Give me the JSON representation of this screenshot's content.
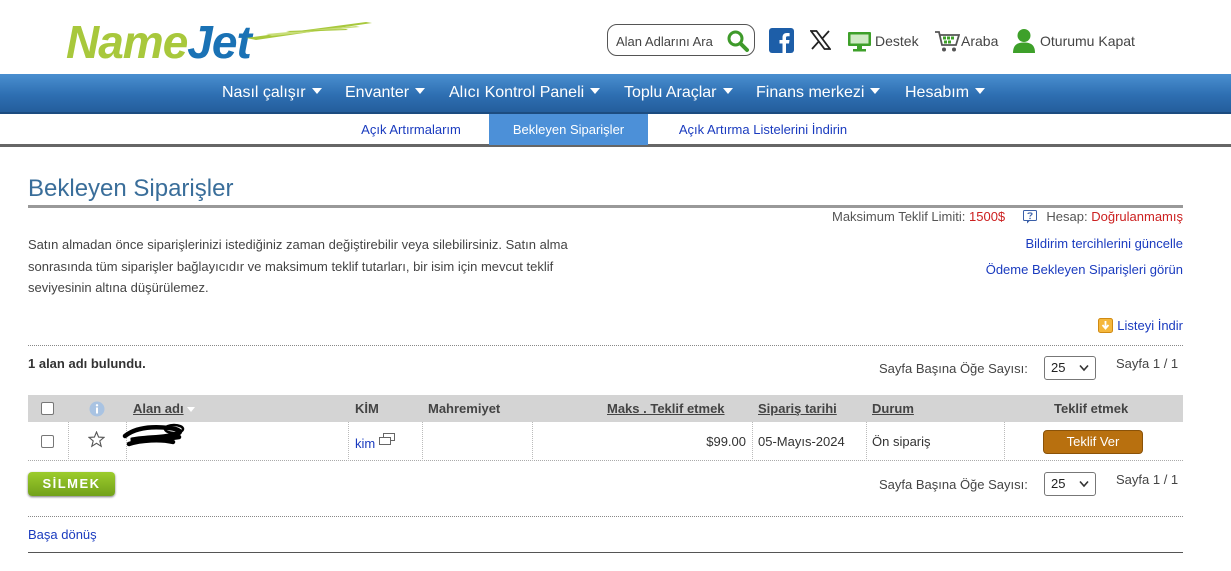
{
  "header": {
    "logo": {
      "part1": "Name",
      "part2": "Jet"
    },
    "search_placeholder": "Alan Adlarını Ara",
    "links": {
      "support": "Destek",
      "cart": "Araba",
      "logout": "Oturumu Kapat"
    }
  },
  "nav": {
    "items": [
      {
        "label": "Nasıl çalışır"
      },
      {
        "label": "Envanter"
      },
      {
        "label": "Alıcı Kontrol Paneli"
      },
      {
        "label": "Toplu Araçlar"
      },
      {
        "label": "Finans merkezi"
      },
      {
        "label": "Hesabım"
      }
    ]
  },
  "subnav": {
    "items": [
      {
        "label": "Açık Artırmalarım",
        "active": false
      },
      {
        "label": "Bekleyen Siparişler",
        "active": true
      },
      {
        "label": "Açık Artırma Listelerini İndirin",
        "active": false
      }
    ]
  },
  "page": {
    "title": "Bekleyen Siparişler",
    "max_limit_label": "Maksimum Teklif Limiti:",
    "max_limit_value": "1500$",
    "account_label": "Hesap:",
    "account_status": "Doğrulanmamış",
    "description": "Satın almadan önce siparişlerinizi istediğiniz zaman değiştirebilir veya silebilirsiniz. Satın alma sonrasında tüm siparişler bağlayıcıdır ve maksimum teklif tutarları, bir isim için mevcut teklif seviyesinin altına düşürülemez.",
    "link_notifications": "Bildirim tercihlerini güncelle",
    "link_pending_payment": "Ödeme Bekleyen Siparişleri görün",
    "download_list": "Listeyi İndir",
    "found_text": "1 alan adı bulundu.",
    "per_page_label": "Sayfa Başına Öğe Sayısı:",
    "per_page_value": "25",
    "page_of": "Sayfa 1 / 1",
    "delete_button": "SİLMEK",
    "back_to_top": "Başa dönüş"
  },
  "table": {
    "headers": {
      "domain": "Alan adı",
      "who": "KİM",
      "privacy": "Mahremiyet",
      "max_bid": "Maks . Teklif etmek",
      "order_date": "Sipariş tarihi",
      "status": "Durum",
      "bid": "Teklif etmek"
    },
    "rows": [
      {
        "domain": "",
        "who": "kim",
        "privacy": "",
        "max_bid": "$99.00",
        "order_date": "05-Mayıs-2024",
        "status": "Ön sipariş",
        "bid_button": "Teklif Ver"
      }
    ]
  },
  "colors": {
    "nav_blue": "#2e6fb2",
    "subnav_active": "#4c90d8",
    "link_blue": "#1a3bbf",
    "title_blue": "#3a6e9a",
    "bid_button": "#b8700f",
    "delete_button": "#8cbf26",
    "warning_red": "#cc2020"
  }
}
